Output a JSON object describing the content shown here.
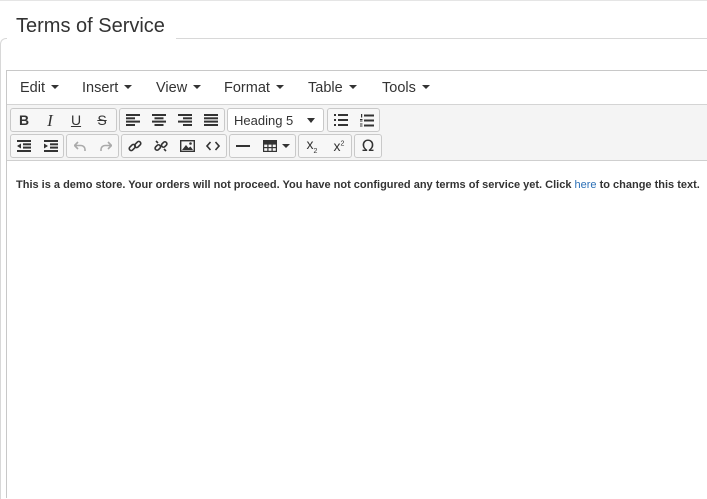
{
  "section": {
    "title": "Terms of Service"
  },
  "menubar": {
    "edit": "Edit",
    "insert": "Insert",
    "view": "View",
    "format": "Format",
    "table": "Table",
    "tools": "Tools"
  },
  "toolbar": {
    "bold": "B",
    "italic": "I",
    "underline": "U",
    "strikethrough": "S",
    "block_format": "Heading 5",
    "subscript_base": "x",
    "subscript_mark": "2",
    "superscript_base": "x",
    "superscript_mark": "2",
    "special_char": "Ω"
  },
  "content": {
    "text_before": "This is a demo store. Your orders will not proceed. You have not configured any terms of service yet. Click ",
    "link": "here",
    "text_after": " to change this text."
  },
  "colors": {
    "link": "#2b6fb6",
    "toolbar_bg": "#f4f4f4",
    "border": "#c9c9c9"
  }
}
